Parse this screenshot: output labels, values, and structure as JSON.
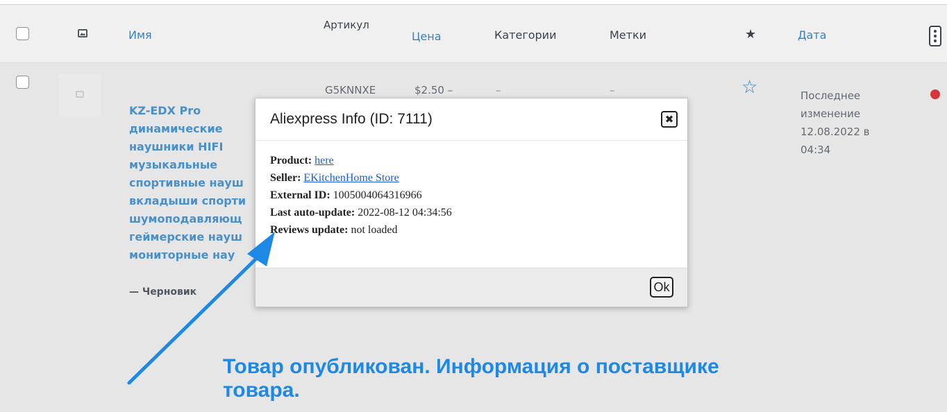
{
  "header": {
    "name": "Имя",
    "sku": "Артикул",
    "price": "Цена",
    "categories": "Категории",
    "tags": "Метки",
    "featured": "★",
    "date": "Дата"
  },
  "product": {
    "name": "KZ-EDX Pro\nдинамические\nнаушники HIFI\nмузыкальные\nспортивные науш\nвкладыши спорти\nшумоподавляющ\nгеймерские науш\nмониторные нау",
    "status": "— Черновик",
    "sku": "G5KNNXE",
    "price": "$2.50 –",
    "categories": "–",
    "tags": "–",
    "featured_icon": "star-outline",
    "date_lines": [
      "Последнее",
      "изменение",
      "12.08.2022 в",
      "04:34"
    ],
    "status_color": "#d63638"
  },
  "dialog": {
    "title": "Aliexpress Info (ID: 7111)",
    "close_label": "✖",
    "product_label": "Product:",
    "product_link": "here",
    "seller_label": "Seller:",
    "seller_link": "EKitchenHome Store",
    "external_id_label": "External ID:",
    "external_id": "1005004064316966",
    "last_update_label": "Last auto-update:",
    "last_update": "2022-08-12 04:34:56",
    "reviews_label": "Reviews update:",
    "reviews_value": "not loaded",
    "ok_label": "Ok"
  },
  "annotation": {
    "caption": "Товар опубликован. Информация о поставщике товара.",
    "color": "#1e88e5"
  }
}
